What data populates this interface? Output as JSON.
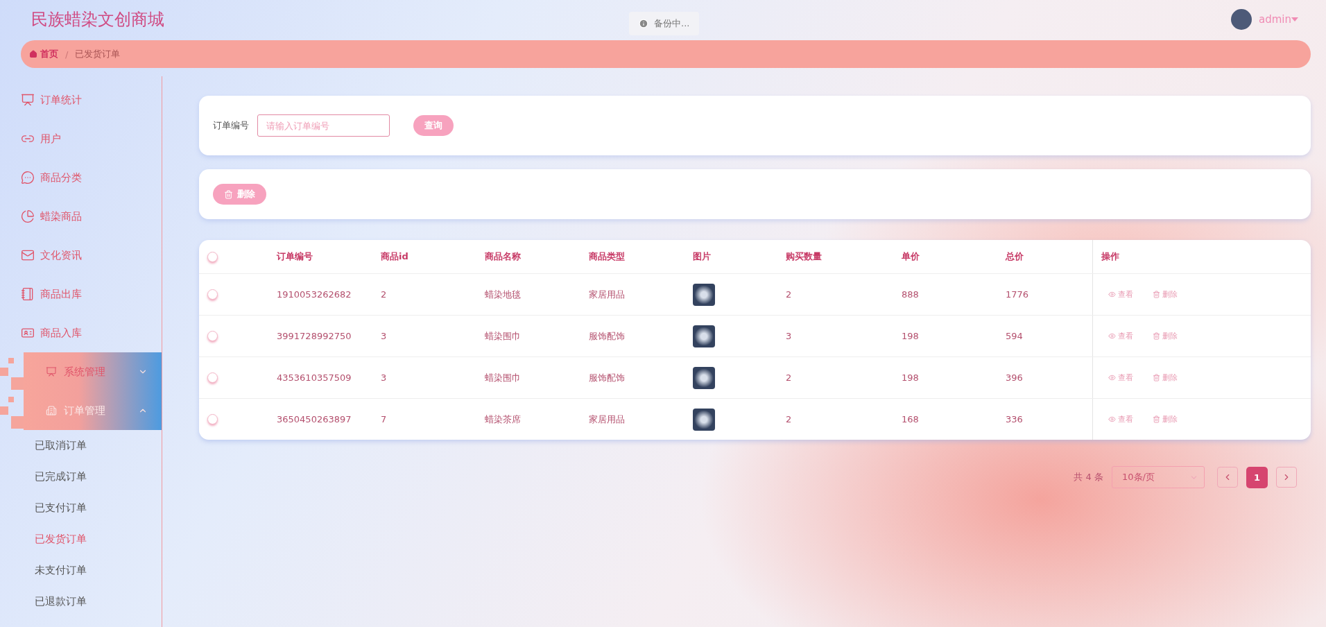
{
  "header": {
    "title": "民族蜡染文创商城",
    "backup_notice": "备份中...",
    "user": "admin"
  },
  "breadcrumb": [
    {
      "label": "首页",
      "kind": "home",
      "separator": "/"
    },
    {
      "label": "已发货订单",
      "kind": "current"
    }
  ],
  "sidebar": {
    "items": [
      {
        "label": "订单统计",
        "kind": "link"
      },
      {
        "label": "用户",
        "kind": "link"
      },
      {
        "label": "商品分类",
        "kind": "link"
      },
      {
        "label": "蜡染商品",
        "kind": "link"
      },
      {
        "label": "文化资讯",
        "kind": "link"
      },
      {
        "label": "商品出库",
        "kind": "link"
      },
      {
        "label": "商品入库",
        "kind": "link"
      },
      {
        "label": "系统管理",
        "kind": "group",
        "expanded": false
      },
      {
        "label": "订单管理",
        "kind": "group",
        "expanded": true,
        "children": [
          {
            "label": "已取消订单",
            "selected": false
          },
          {
            "label": "已完成订单",
            "selected": false
          },
          {
            "label": "已支付订单",
            "selected": false
          },
          {
            "label": "已发货订单",
            "selected": true
          },
          {
            "label": "未支付订单",
            "selected": false
          },
          {
            "label": "已退款订单",
            "selected": false
          }
        ]
      }
    ]
  },
  "search": {
    "label": "订单编号",
    "placeholder": "请输入订单编号",
    "button": "查询"
  },
  "toolbar": {
    "delete_button": "删除"
  },
  "table": {
    "header_checked": false,
    "columns": [
      "订单编号",
      "商品id",
      "商品名称",
      "商品类型",
      "图片",
      "购买数量",
      "单价",
      "总价",
      "操作"
    ],
    "rows": [
      {
        "checked": false,
        "cells": [
          "1910053262682",
          "2",
          "蜡染地毯",
          "家居用品"
        ],
        "qty": "2",
        "price": "888",
        "total": "1776",
        "actions": [
          "查看",
          "删除"
        ]
      },
      {
        "checked": false,
        "cells": [
          "3991728992750",
          "3",
          "蜡染围巾",
          "服饰配饰"
        ],
        "qty": "3",
        "price": "198",
        "total": "594",
        "actions": [
          "查看",
          "删除"
        ]
      },
      {
        "checked": false,
        "cells": [
          "4353610357509",
          "3",
          "蜡染围巾",
          "服饰配饰"
        ],
        "qty": "2",
        "price": "198",
        "total": "396",
        "actions": [
          "查看",
          "删除"
        ]
      },
      {
        "checked": false,
        "cells": [
          "3650450263897",
          "7",
          "蜡染茶席",
          "家居用品"
        ],
        "qty": "2",
        "price": "168",
        "total": "336",
        "actions": [
          "查看",
          "删除"
        ]
      }
    ]
  },
  "pagination": {
    "total": "共 4 条",
    "page_size": "10条/页",
    "pages": [
      {
        "label": "1",
        "selected": true
      }
    ]
  }
}
